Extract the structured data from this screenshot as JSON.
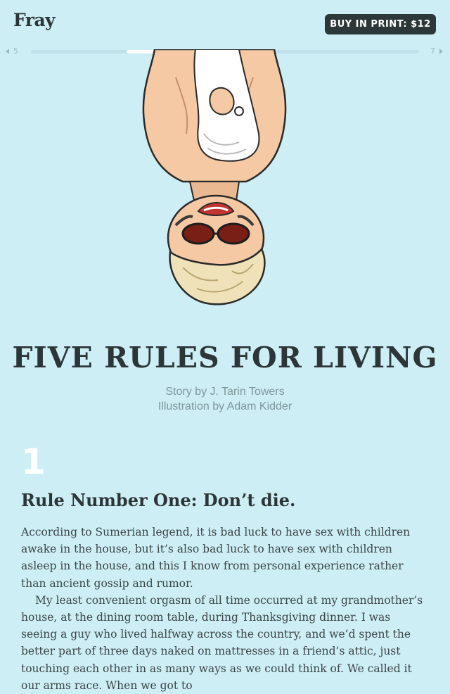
{
  "header": {
    "logo": "Fray",
    "buy_label": "BUY IN PRINT: $12"
  },
  "pager": {
    "prev_page": "5",
    "next_page": "7"
  },
  "story": {
    "title": "FIVE RULES FOR LIVING",
    "story_credit": "Story by J. Tarin Towers",
    "illustration_credit": "Illustration by Adam Kidder"
  },
  "section": {
    "number": "1",
    "heading": "Rule Number One: Don’t die.",
    "paragraphs": [
      "According to Sumerian legend, it is bad luck to have sex with children awake in the house, but it’s also bad luck to have sex with children asleep in the house, and this I know from personal experience rather than ancient gossip and rumor.",
      "My least convenient orgasm of all time occurred at my grandmother’s house, at the dining room table, during Thanksgiving dinner. I was seeing a guy who lived halfway across the country, and we’d spent the better part of three days naked on mattresses in a friend’s attic, just touching each other in as many ways as we could think of. We called it our arms race. When we got to"
    ]
  },
  "colors": {
    "background": "#cdeef5",
    "button_bg": "#2c3739",
    "section_number": "#ffffff"
  },
  "icons": {
    "prev": "triangle-left-icon",
    "next": "triangle-right-icon"
  }
}
